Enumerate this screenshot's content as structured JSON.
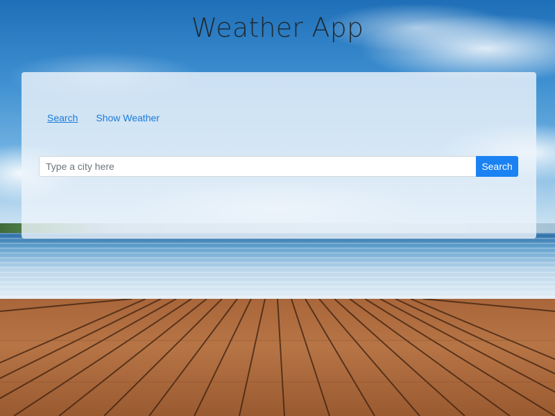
{
  "header": {
    "title": "Weather App"
  },
  "nav": {
    "items": [
      {
        "label": "Search",
        "active": true
      },
      {
        "label": "Show Weather",
        "active": false
      }
    ]
  },
  "search": {
    "value": "",
    "placeholder": "Type a city here",
    "button_label": "Search"
  },
  "colors": {
    "link": "#1a7ad9",
    "button": "#1a82f2",
    "title": "#1f2a33"
  }
}
